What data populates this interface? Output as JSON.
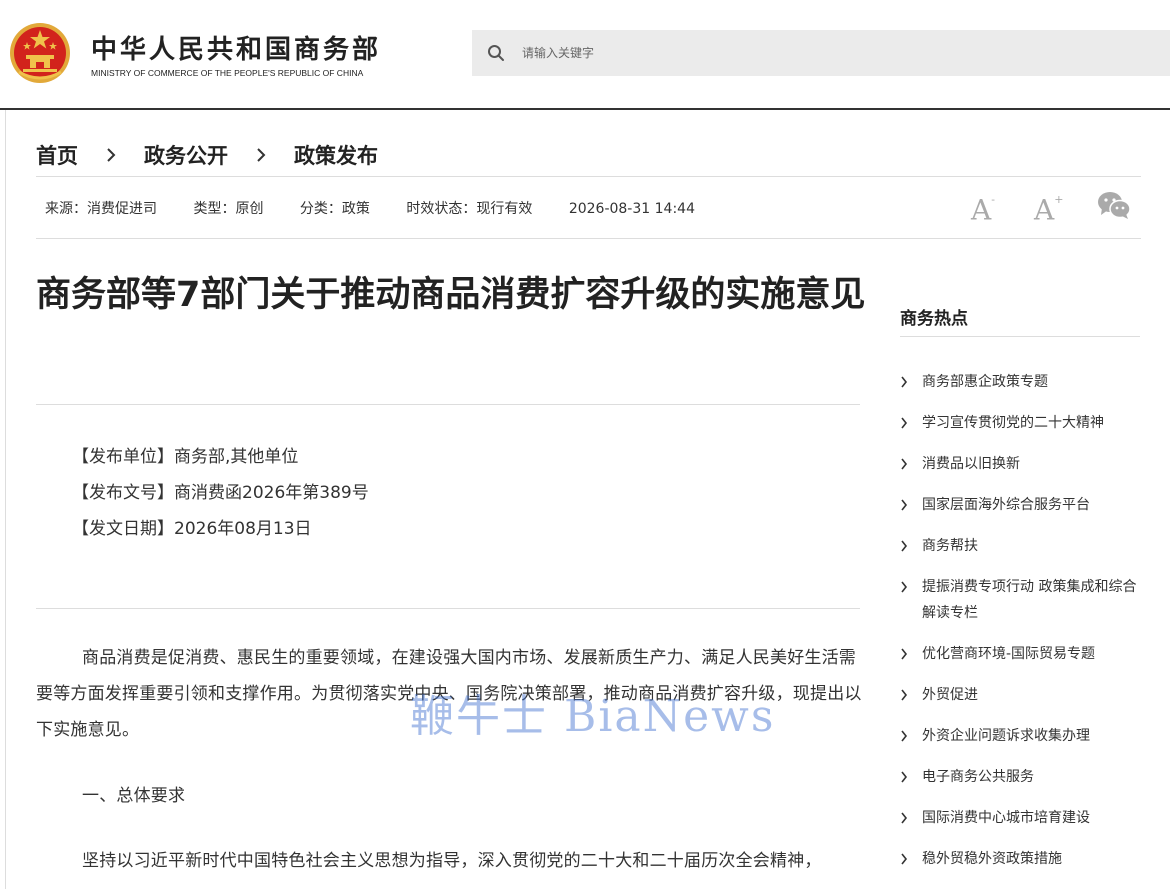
{
  "header": {
    "ministry_cn": "中华人民共和国商务部",
    "ministry_en": "MINISTRY OF COMMERCE OF THE PEOPLE'S REPUBLIC OF CHINA",
    "search_placeholder": "请输入关键字"
  },
  "breadcrumb": [
    "首页",
    "政务公开",
    "政策发布"
  ],
  "meta": {
    "source": "来源：消费促进司",
    "type": "类型：原创",
    "category": "分类：政策",
    "status": "时效状态：现行有效",
    "datetime": "2026-08-31 14:44"
  },
  "tools": {
    "decrease_font": "A",
    "increase_font": "A",
    "share_icon": "wechat-icon"
  },
  "article": {
    "title": "商务部等7部门关于推动商品消费扩容升级的实施意见",
    "info": [
      "【发布单位】商务部,其他单位",
      "【发布文号】商消费函2026年第389号",
      "【发文日期】2026年08月13日"
    ],
    "paragraphs": [
      "商品消费是促消费、惠民生的重要领域，在建设强大国内市场、发展新质生产力、满足人民美好生活需要等方面发挥重要引领和支撑作用。为贯彻落实党中央、国务院决策部署，推动商品消费扩容升级，现提出以下实施意见。",
      "一、总体要求",
      "坚持以习近平新时代中国特色社会主义思想为指导，深入贯彻党的二十大和二十届历次全会精神，"
    ],
    "watermark": "鞭牛士 BiaNews"
  },
  "sidebar": {
    "title": "商务热点",
    "items": [
      "商务部惠企政策专题",
      "学习宣传贯彻党的二十大精神",
      "消费品以旧换新",
      "国家层面海外综合服务平台",
      "商务帮扶",
      "提振消费专项行动 政策集成和综合解读专栏",
      "优化营商环境-国际贸易专题",
      "外贸促进",
      "外资企业问题诉求收集办理",
      "电子商务公共服务",
      "国际消费中心城市培育建设",
      "稳外贸稳外资政策措施"
    ]
  },
  "colors": {
    "emblem_red": "#d2231c",
    "emblem_gold": "#f0c24b",
    "watermark_blue": "#3d6fd0"
  }
}
